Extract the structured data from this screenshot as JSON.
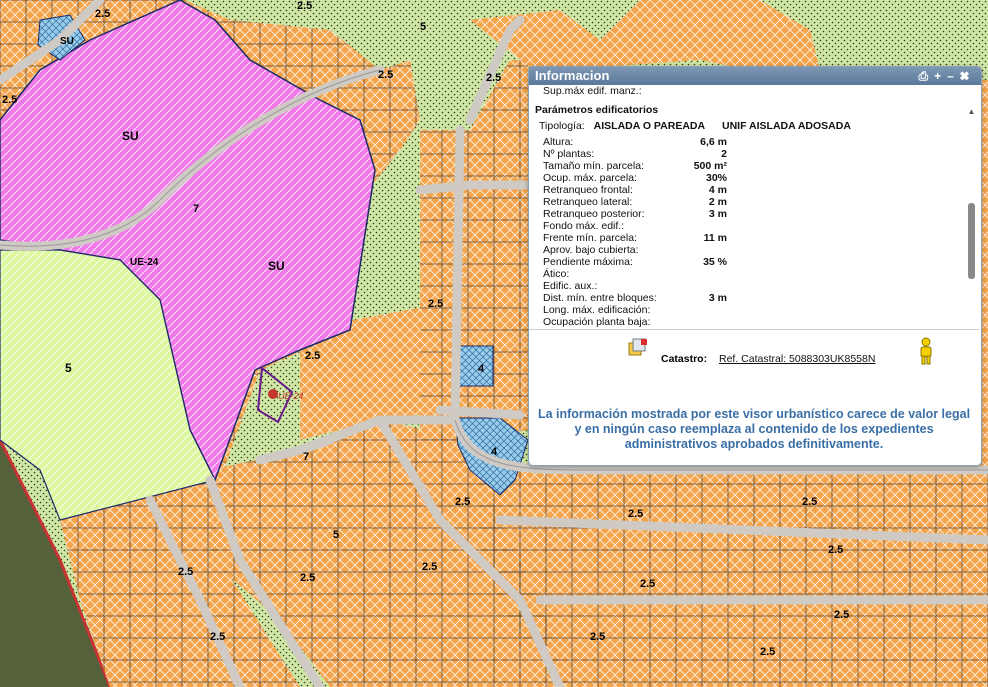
{
  "map": {
    "zone_labels": {
      "su_1": "SU",
      "su_2": "SU",
      "ue24": "UE-24",
      "z5_left": "5",
      "z5_top": "5",
      "z5_mid": "5",
      "z7_top": "7",
      "z7_road": "7",
      "z4_a": "4",
      "z4_b": "4",
      "z25_a": "2.5",
      "z25_b": "2.5",
      "z25_c": "2.5",
      "z25_d": "2.5",
      "z25_e": "2.5",
      "z25_f": "2.5",
      "z25_g": "2.5",
      "z25_h": "2.5",
      "z25_i": "2.5",
      "z25_j": "2.5",
      "z25_k": "2.5",
      "z25_l": "2.5",
      "z25_m": "2.5",
      "z25_n": "2.5",
      "z25_o": "2.5",
      "z25_p": "2.5",
      "z25_q": "2.5",
      "z25_r": "2.5",
      "z25_s": "2.5",
      "su_small": "SU",
      "marker_label": "UE-24"
    },
    "colors": {
      "residential": "#f4a44a",
      "su_magenta": "#f07be8",
      "green": "#d8f59a",
      "stipple_green": "#cfe8a8",
      "blue_block": "#9bcbea",
      "road": "#d4d0cc",
      "boundary": "#1b2a66"
    }
  },
  "panel": {
    "title": "Informacion",
    "tool_icons": [
      "print-icon",
      "maximize-icon",
      "minimize-icon",
      "close-icon"
    ],
    "sup_max": "Sup.máx edif. manz.:",
    "section_title": "Parámetros edificatorios",
    "tipologia_label": "Tipología:",
    "tipologia_1": "AISLADA O PAREADA",
    "tipologia_2": "UNIF AISLADA ADOSADA",
    "params": [
      {
        "k": "Altura:",
        "v": "6,6 m"
      },
      {
        "k": "Nº plantas:",
        "v": "2"
      },
      {
        "k": "Tamaño mín. parcela:",
        "v": "500 m²"
      },
      {
        "k": "Ocup. máx. parcela:",
        "v": "30%"
      },
      {
        "k": "Retranqueo frontal:",
        "v": "4 m"
      },
      {
        "k": "Retranqueo lateral:",
        "v": "2 m"
      },
      {
        "k": "Retranqueo posterior:",
        "v": "3 m"
      },
      {
        "k": "Fondo máx. edif.:",
        "v": ""
      },
      {
        "k": "Frente mín. parcela:",
        "v": "11 m"
      },
      {
        "k": "Aprov. bajo cubierta:",
        "v": ""
      },
      {
        "k": "Pendiente máxima:",
        "v": "35 %"
      },
      {
        "k": "Ático:",
        "v": ""
      },
      {
        "k": "Edific. aux.:",
        "v": ""
      },
      {
        "k": "Dist. mín. entre bloques:",
        "v": "3 m"
      },
      {
        "k": "Long. máx. edificación:",
        "v": ""
      },
      {
        "k": "Ocupación planta baja:",
        "v": ""
      }
    ],
    "catastro_label": "Catastro:",
    "catastro_ref": "Ref. Catastral: 5088303UK8558N",
    "disclaimer": "La información mostrada por este visor urbanístico carece de valor legal y en ningún caso reemplaza al contenido de los expedientes administrativos aprobados definitivamente."
  }
}
